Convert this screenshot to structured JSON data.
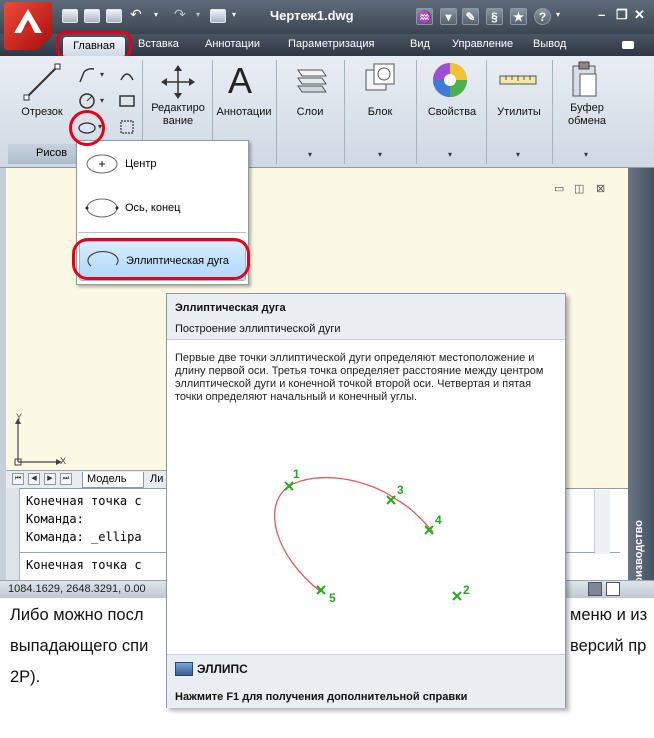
{
  "window": {
    "title": "Чертеж1.dwg",
    "minimize": "–",
    "restore": "❐",
    "close": "✕"
  },
  "tabs": [
    "Главная",
    "Вставка",
    "Аннотации",
    "Параметризация",
    "Вид",
    "Управление",
    "Вывод"
  ],
  "ribbon": {
    "line_label": "Отрезок",
    "draw_panel": "Рисов",
    "modify_label": "Редактиро вание",
    "annotation_label": "Аннотации",
    "layers_label": "Слои",
    "block_label": "Блок",
    "properties_label": "Свойства",
    "utilities_label": "Утилиты",
    "clipboard_label": "Буфер обмена"
  },
  "dropdown": {
    "items": [
      "Центр",
      "Ось, конец",
      "Эллиптическая дуга"
    ],
    "selected_index": 2
  },
  "tooltip": {
    "title": "Эллиптическая дуга",
    "subtitle": "Построение эллиптической дуги",
    "body": "Первые две точки эллиптической дуги определяют местоположение и длину первой оси. Третья точка определяет расстояние между центром эллиптической дуги и конечной точкой второй оси. Четвертая и пятая точки определяют начальный и конечный углы.",
    "point_labels": [
      "1",
      "2",
      "3",
      "4",
      "5"
    ],
    "command": "ЭЛЛИПС",
    "help": "Нажмите F1 для получения дополнительной справки"
  },
  "layout_tabs": {
    "model": "Модель",
    "sheet": "Ли"
  },
  "command_line": {
    "lines": [
      "Конечная точка с",
      "Команда:",
      "Команда: _ellipa",
      "Конечная точка с"
    ]
  },
  "status": {
    "coords": "1084.1629, 2648.3291, 0.00"
  },
  "palette": {
    "title": "Палитры инструментов - Производство"
  },
  "viewport_controls": [
    "▭",
    "◫",
    "⊠"
  ],
  "ucs": {
    "x_label": "X",
    "y_label": "Y"
  },
  "article": {
    "line1_left": "Либо можно посл",
    "line1_right": "меню и из",
    "line2_left": "выпадающего спи",
    "line2_right": "версий пр",
    "line3": "2P)."
  },
  "colors": {
    "highlight": "#e3001b",
    "curve": "#e05a5a",
    "point": "#22aa22"
  }
}
